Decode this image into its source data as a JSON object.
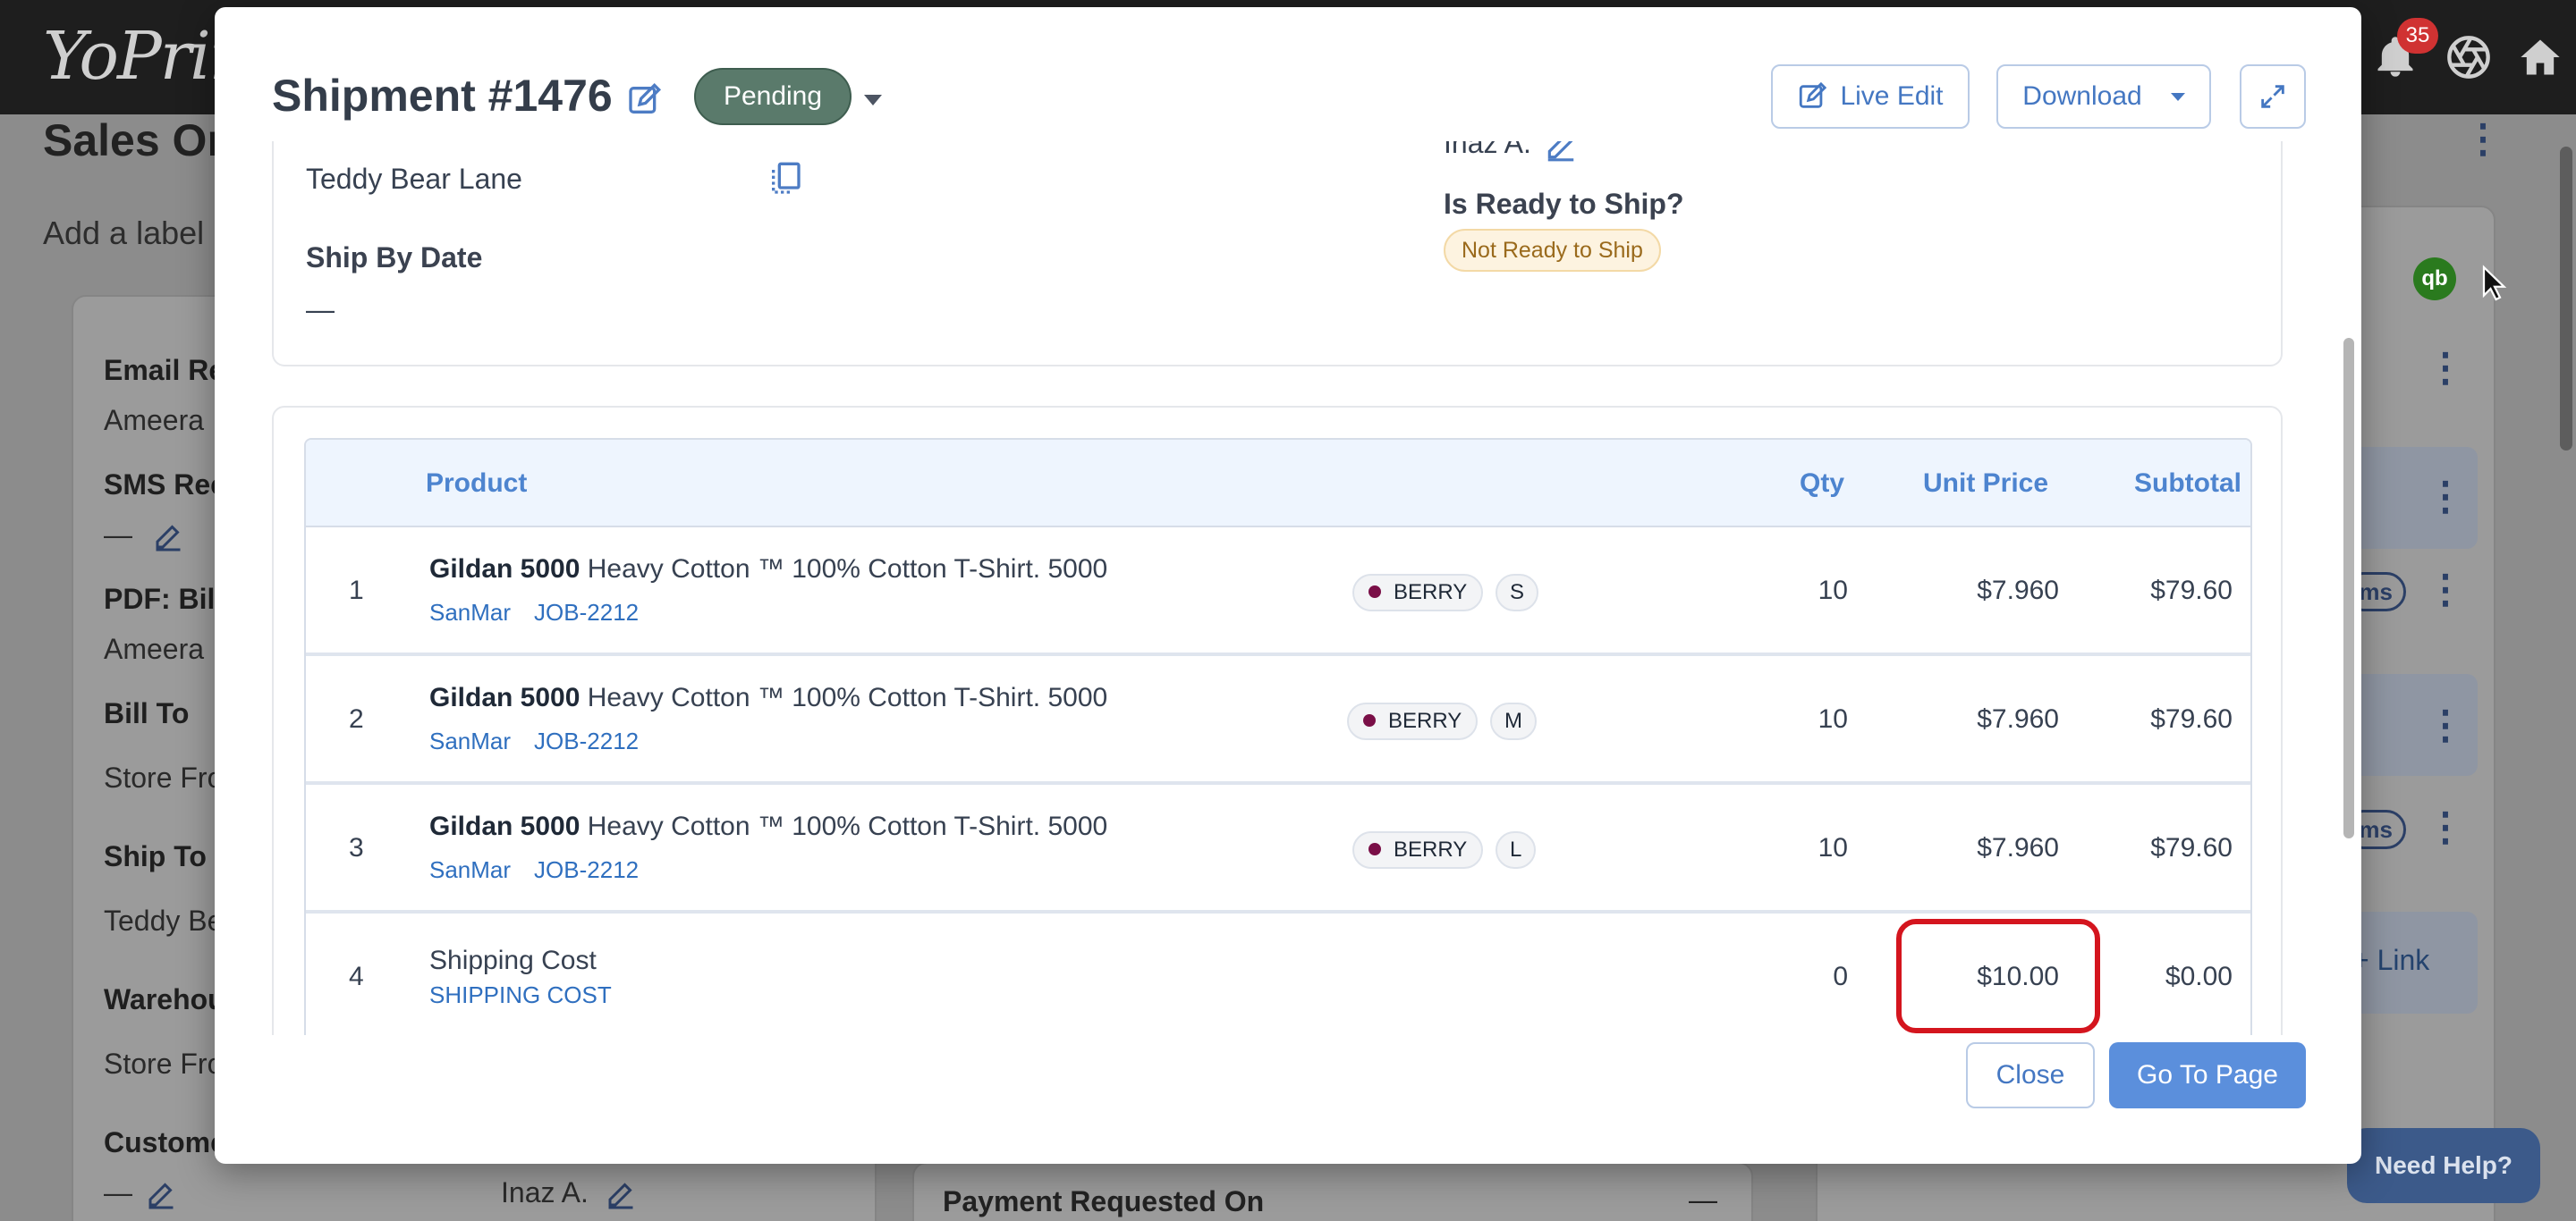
{
  "app": {
    "logo": "YoPrint",
    "notification_count": "35",
    "page_title": "Sales Or",
    "add_label": "Add a label",
    "left_card": {
      "email_label": "Email Re",
      "email_value": "Ameera",
      "sms_label": "SMS Rec",
      "sms_value": "—",
      "pdf_label": "PDF: Bill",
      "pdf_value": "Ameera",
      "bill_to_label": "Bill To",
      "bill_to_value": "Store Fro",
      "ship_to_label": "Ship To",
      "ship_to_value": "Teddy Be",
      "warehouse_label": "Warehou",
      "warehouse_value": "Store Fro",
      "customer_label": "Custome",
      "customer_value": "—",
      "assignee_value": "Inaz A."
    },
    "payment_requested": "Payment Requested On",
    "payment_dash": "—",
    "right_pill_text": "ms",
    "link_text": "+ Link",
    "qb_text": "qb",
    "need_help": "Need Help?"
  },
  "modal": {
    "title": "Shipment #1476",
    "status": "Pending",
    "live_edit": "Live Edit",
    "download": "Download",
    "info": {
      "ship_to_address": "Teddy Bear Lane",
      "ship_by_label": "Ship By Date",
      "ship_by_value": "—",
      "assignee": "Inaz A.",
      "ready_label": "Is Ready to Ship?",
      "ready_value": "Not Ready to Ship"
    },
    "table": {
      "headers": {
        "product": "Product",
        "qty": "Qty",
        "unit_price": "Unit Price",
        "subtotal": "Subtotal"
      },
      "rows": [
        {
          "num": "1",
          "brand": "Gildan 5000",
          "name": "Heavy Cotton ™ 100% Cotton T-Shirt. 5000",
          "supplier": "SanMar",
          "job": "JOB-2212",
          "color": "BERRY",
          "size": "S",
          "qty": "10",
          "unit_price": "$7.960",
          "subtotal": "$79.60"
        },
        {
          "num": "2",
          "brand": "Gildan 5000",
          "name": "Heavy Cotton ™ 100% Cotton T-Shirt. 5000",
          "supplier": "SanMar",
          "job": "JOB-2212",
          "color": "BERRY",
          "size": "M",
          "qty": "10",
          "unit_price": "$7.960",
          "subtotal": "$79.60"
        },
        {
          "num": "3",
          "brand": "Gildan 5000",
          "name": "Heavy Cotton ™ 100% Cotton T-Shirt. 5000",
          "supplier": "SanMar",
          "job": "JOB-2212",
          "color": "BERRY",
          "size": "L",
          "qty": "10",
          "unit_price": "$7.960",
          "subtotal": "$79.60"
        },
        {
          "num": "4",
          "name": "Shipping Cost",
          "code": "SHIPPING COST",
          "qty": "0",
          "unit_price": "$10.00",
          "subtotal": "$0.00"
        }
      ]
    },
    "close": "Close",
    "go_to_page": "Go To Page"
  },
  "colors": {
    "accent": "#4477c2",
    "status_pending": "#5a7a6b",
    "highlight": "#d4151e",
    "berry": "#7a0f47"
  }
}
